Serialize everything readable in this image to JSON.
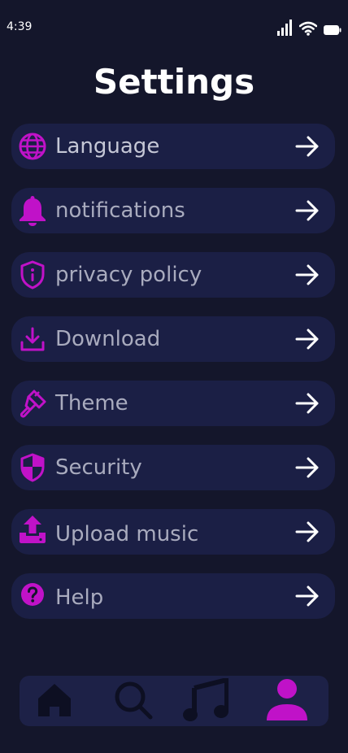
{
  "status_bar": {
    "time": "4:39"
  },
  "page": {
    "title": "Settings"
  },
  "colors": {
    "background": "#14162b",
    "card": "#1b1f45",
    "accent": "#c012c8",
    "label": "#a9abbe",
    "tab_inactive": "#0d0f22"
  },
  "settings": {
    "items": [
      {
        "label": "Language",
        "icon": "globe-icon"
      },
      {
        "label": "notifications",
        "icon": "bell-icon"
      },
      {
        "label": "privacy policy",
        "icon": "shield-info-icon"
      },
      {
        "label": "Download",
        "icon": "download-icon"
      },
      {
        "label": "Theme",
        "icon": "paint-brush-icon"
      },
      {
        "label": "Security",
        "icon": "shield-half-icon"
      },
      {
        "label": "Upload music",
        "icon": "upload-icon"
      },
      {
        "label": "Help",
        "icon": "question-circle-icon"
      }
    ]
  },
  "tab_bar": {
    "tabs": [
      {
        "icon": "home-icon",
        "active": false
      },
      {
        "icon": "search-icon",
        "active": false
      },
      {
        "icon": "music-note-icon",
        "active": false
      },
      {
        "icon": "profile-icon",
        "active": true
      }
    ]
  }
}
